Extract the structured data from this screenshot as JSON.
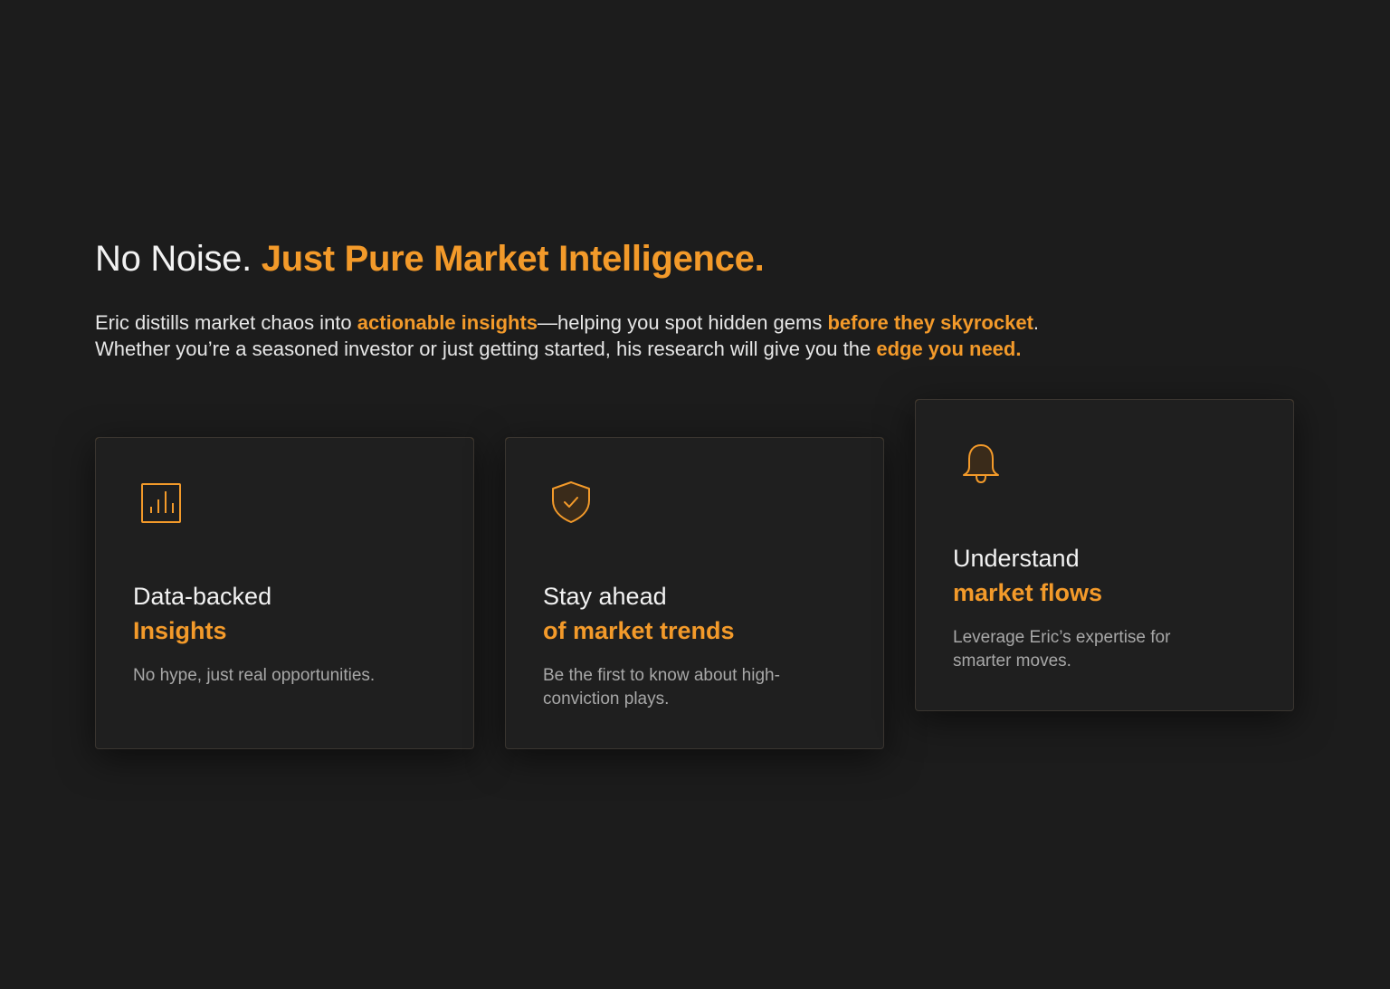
{
  "heading": {
    "plain": "No Noise. ",
    "accent": "Just Pure Market Intelligence."
  },
  "intro": {
    "line1_a": "Eric distills market chaos into ",
    "line1_hl1": "actionable insights",
    "line1_b": "—helping you spot hidden gems ",
    "line1_hl2": "before they skyrocket",
    "line1_c": ".",
    "line2_a": "Whether you’re a seasoned investor or just getting started, his research will give you the ",
    "line2_hl": "edge you need."
  },
  "cards": [
    {
      "icon": "bar-chart-icon",
      "title": "Data-backed",
      "accent": "Insights",
      "desc": "No hype, just real opportunities."
    },
    {
      "icon": "shield-check-icon",
      "title": "Stay ahead",
      "accent": "of market trends",
      "desc": "Be the first to know about high-conviction plays."
    },
    {
      "icon": "bell-icon",
      "title": "Understand",
      "accent": "market flows",
      "desc": "Leverage Eric’s expertise for smarter moves."
    }
  ],
  "colors": {
    "background": "#1c1c1c",
    "accent": "#f39a2a",
    "text": "#f2f2f2",
    "muted": "#a8a8a8"
  }
}
